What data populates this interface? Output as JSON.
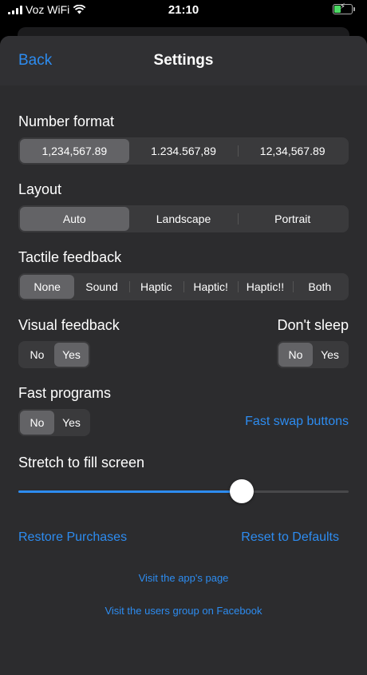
{
  "status": {
    "carrier": "Voz WiFi",
    "time": "21:10"
  },
  "nav": {
    "back": "Back",
    "title": "Settings"
  },
  "number_format": {
    "label": "Number format",
    "options": [
      "1,234,567.89",
      "1.234.567,89",
      "12,34,567.89"
    ],
    "selected": 0
  },
  "layout": {
    "label": "Layout",
    "options": [
      "Auto",
      "Landscape",
      "Portrait"
    ],
    "selected": 0
  },
  "tactile": {
    "label": "Tactile feedback",
    "options": [
      "None",
      "Sound",
      "Haptic",
      "Haptic!",
      "Haptic!!",
      "Both"
    ],
    "selected": 0
  },
  "visual": {
    "label": "Visual feedback",
    "options": [
      "No",
      "Yes"
    ],
    "selected": 1
  },
  "dont_sleep": {
    "label": "Don't sleep",
    "options": [
      "No",
      "Yes"
    ],
    "selected": 0
  },
  "fast_programs": {
    "label": "Fast programs",
    "options": [
      "No",
      "Yes"
    ],
    "selected": 0
  },
  "fast_swap": "Fast swap buttons",
  "stretch": {
    "label": "Stretch to fill screen",
    "value": 0.69
  },
  "restore": "Restore Purchases",
  "reset": "Reset to Defaults",
  "visit_page": "Visit the app's page",
  "visit_group": "Visit the users group on Facebook",
  "colors": {
    "accent": "#2d8cf0",
    "background": "#2c2c2e",
    "segment": "#3a3a3c",
    "selected": "#636366"
  }
}
